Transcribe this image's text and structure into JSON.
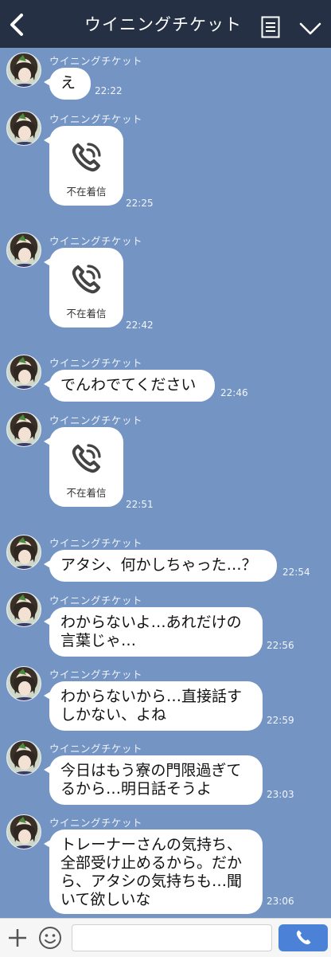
{
  "header": {
    "title": "ウイニングチケット",
    "back_icon": "chevron-left-icon",
    "menu_icon": "list-icon",
    "expand_icon": "chevron-down-icon"
  },
  "colors": {
    "header_bg": "#253045",
    "chat_bg": "#7494c4",
    "bubble": "#ffffff",
    "send": "#4b82d8"
  },
  "messages": [
    {
      "sender": "ウイニングチケット",
      "type": "text",
      "text": "え",
      "time": "22:22"
    },
    {
      "sender": "ウイニングチケット",
      "type": "call",
      "text": "不在着信",
      "time": "22:25"
    },
    {
      "sender": "ウイニングチケット",
      "type": "call",
      "text": "不在着信",
      "time": "22:42"
    },
    {
      "sender": "ウイニングチケット",
      "type": "text",
      "text": "でんわでてください",
      "time": "22:46"
    },
    {
      "sender": "ウイニングチケット",
      "type": "call",
      "text": "不在着信",
      "time": "22:51"
    },
    {
      "sender": "ウイニングチケット",
      "type": "text",
      "text": "アタシ、何かしちゃった…？",
      "time": "22:54"
    },
    {
      "sender": "ウイニングチケット",
      "type": "text",
      "text": "わからないよ…あれだけの\n言葉じゃ…",
      "time": "22:56"
    },
    {
      "sender": "ウイニングチケット",
      "type": "text",
      "text": "わからないから…直接話す\nしかない、よね",
      "time": "22:59"
    },
    {
      "sender": "ウイニングチケット",
      "type": "text",
      "text": "今日はもう寮の門限過ぎて\nるから…明日話そうよ",
      "time": "23:03"
    },
    {
      "sender": "ウイニングチケット",
      "type": "text",
      "text": "トレーナーさんの気持ち、\n全部受け止めるから。だか\nら、アタシの気持ちも…聞\nいて欲しいな",
      "time": "23:06"
    }
  ],
  "footer": {
    "plus_icon": "plus-icon",
    "emoji_icon": "emoji-icon",
    "input_value": "",
    "send_icon": "phone-icon"
  }
}
